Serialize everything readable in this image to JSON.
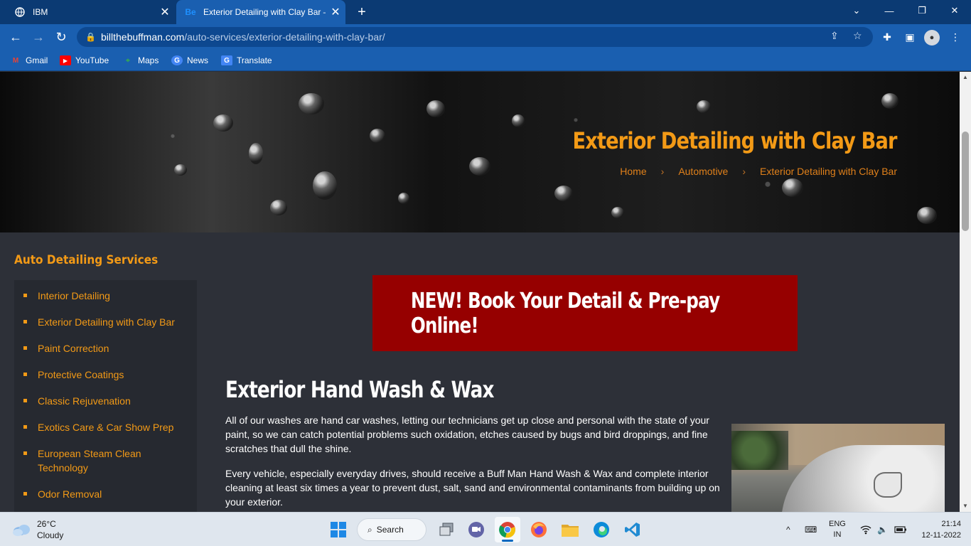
{
  "browser": {
    "tabs": [
      {
        "title": "IBM",
        "favicon": "globe-icon",
        "active": false
      },
      {
        "title": "Exterior Detailing with Clay Bar –",
        "favicon": "Be",
        "active": true
      }
    ],
    "url_host": "billthebuffman.com",
    "url_path": "/auto-services/exterior-detailing-with-clay-bar/",
    "bookmarks": [
      {
        "label": "Gmail",
        "icon": "M"
      },
      {
        "label": "YouTube",
        "icon": "▶"
      },
      {
        "label": "Maps",
        "icon": "⌖"
      },
      {
        "label": "News",
        "icon": "G"
      },
      {
        "label": "Translate",
        "icon": "G"
      }
    ],
    "colors": {
      "chrome_dark": "#0b3a73",
      "chrome": "#1a5fb0"
    }
  },
  "hero": {
    "title": "Exterior Detailing with Clay Bar",
    "breadcrumb": [
      "Home",
      "Automotive",
      "Exterior Detailing with Clay Bar"
    ],
    "breadcrumb_sep": "›"
  },
  "sidebar": {
    "title": "Auto Detailing Services",
    "items": [
      "Interior Detailing",
      "Exterior Detailing with Clay Bar",
      "Paint Correction",
      "Protective Coatings",
      "Classic Rejuvenation",
      "Exotics Care & Car Show Prep",
      "European Steam Clean Technology",
      "Odor Removal"
    ]
  },
  "main": {
    "cta": "NEW! Book Your Detail & Pre-pay Online!",
    "heading": "Exterior Hand Wash & Wax",
    "paragraphs": [
      "All of our washes are hand car washes, letting our technicians get up close and personal with the state of your paint, so we can catch potential problems such oxidation, etches caused by bugs and bird droppings, and fine scratches that dull the shine.",
      "Every vehicle, especially everyday drives, should receive a Buff Man Hand Wash & Wax and complete interior cleaning at least six times a year to prevent dust, salt, sand and environmental contaminants from building up on your exterior."
    ],
    "colors": {
      "accent": "#f39a16",
      "cta_bg": "#960000",
      "page_bg": "#2d3038"
    }
  },
  "taskbar": {
    "weather_temp": "26°C",
    "weather_desc": "Cloudy",
    "search_label": "Search",
    "lang_top": "ENG",
    "lang_bottom": "IN",
    "time": "21:14",
    "date": "12-11-2022"
  }
}
